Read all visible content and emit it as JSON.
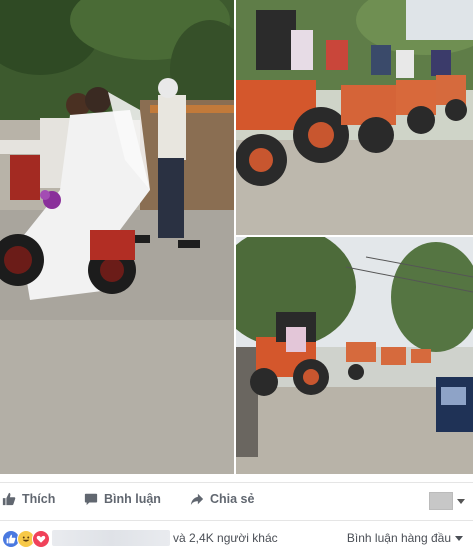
{
  "actions": {
    "like_label": "Thích",
    "comment_label": "Bình luận",
    "share_label": "Chia sẻ"
  },
  "reactions": {
    "icons": [
      "like-icon",
      "haha-icon",
      "love-icon"
    ],
    "others_text": "và 2,4K người khác",
    "sort_label": "Bình luận hàng đầu"
  },
  "photos": [
    {
      "name": "bride-groom-motorbike-photo"
    },
    {
      "name": "tractor-convoy-photo-top"
    },
    {
      "name": "tractor-convoy-photo-bottom"
    }
  ],
  "colors": {
    "link_blue": "#4267b2",
    "action_gray": "#616770",
    "like_blue": "#4a79e0",
    "love_red": "#f0425a",
    "haha_yellow": "#f7c948"
  }
}
